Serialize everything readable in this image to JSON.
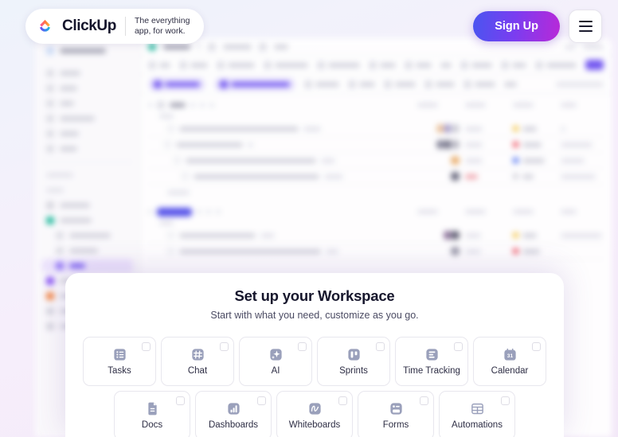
{
  "header": {
    "logo_icon": "clickup-logo-icon",
    "brand": "ClickUp",
    "tagline": "The everything\napp, for work.",
    "signup_label": "Sign Up",
    "menu_icon": "hamburger-menu-icon"
  },
  "modal": {
    "title": "Set up your Workspace",
    "subtitle": "Start with what you need, customize as you go.",
    "row1": [
      {
        "label": "Tasks",
        "icon": "list-icon"
      },
      {
        "label": "Chat",
        "icon": "hash-grid-icon"
      },
      {
        "label": "AI",
        "icon": "sparkle-icon"
      },
      {
        "label": "Sprints",
        "icon": "sprints-board-icon"
      },
      {
        "label": "Time Tracking",
        "icon": "time-tracking-icon"
      },
      {
        "label": "Calendar",
        "icon": "calendar-31-icon"
      }
    ],
    "row2": [
      {
        "label": "Docs",
        "icon": "document-icon"
      },
      {
        "label": "Dashboards",
        "icon": "bar-chart-icon"
      },
      {
        "label": "Whiteboards",
        "icon": "scribble-icon"
      },
      {
        "label": "Forms",
        "icon": "form-icon"
      },
      {
        "label": "Automations",
        "icon": "table-grid-icon"
      }
    ]
  },
  "colors": {
    "brand_purple": "#7b3ff2",
    "accent_blue": "#4a55f0",
    "accent_magenta": "#b829d8",
    "icon_grey": "#9aa0bb",
    "priority_high": "#f5c542",
    "priority_urgent": "#f04a5a",
    "priority_medium": "#4a6df0",
    "priority_low": "#b9b9c6"
  },
  "backdrop": {
    "note": "blurred ClickUp app behind overlay",
    "sidebar_items": 6,
    "sidebar_spaces": 6,
    "task_rows_group1": 4,
    "task_rows_group2": 2,
    "priority_dots": [
      "#f5c542",
      "#f04a5a",
      "#4a6df0",
      "#b9b9c6"
    ]
  }
}
